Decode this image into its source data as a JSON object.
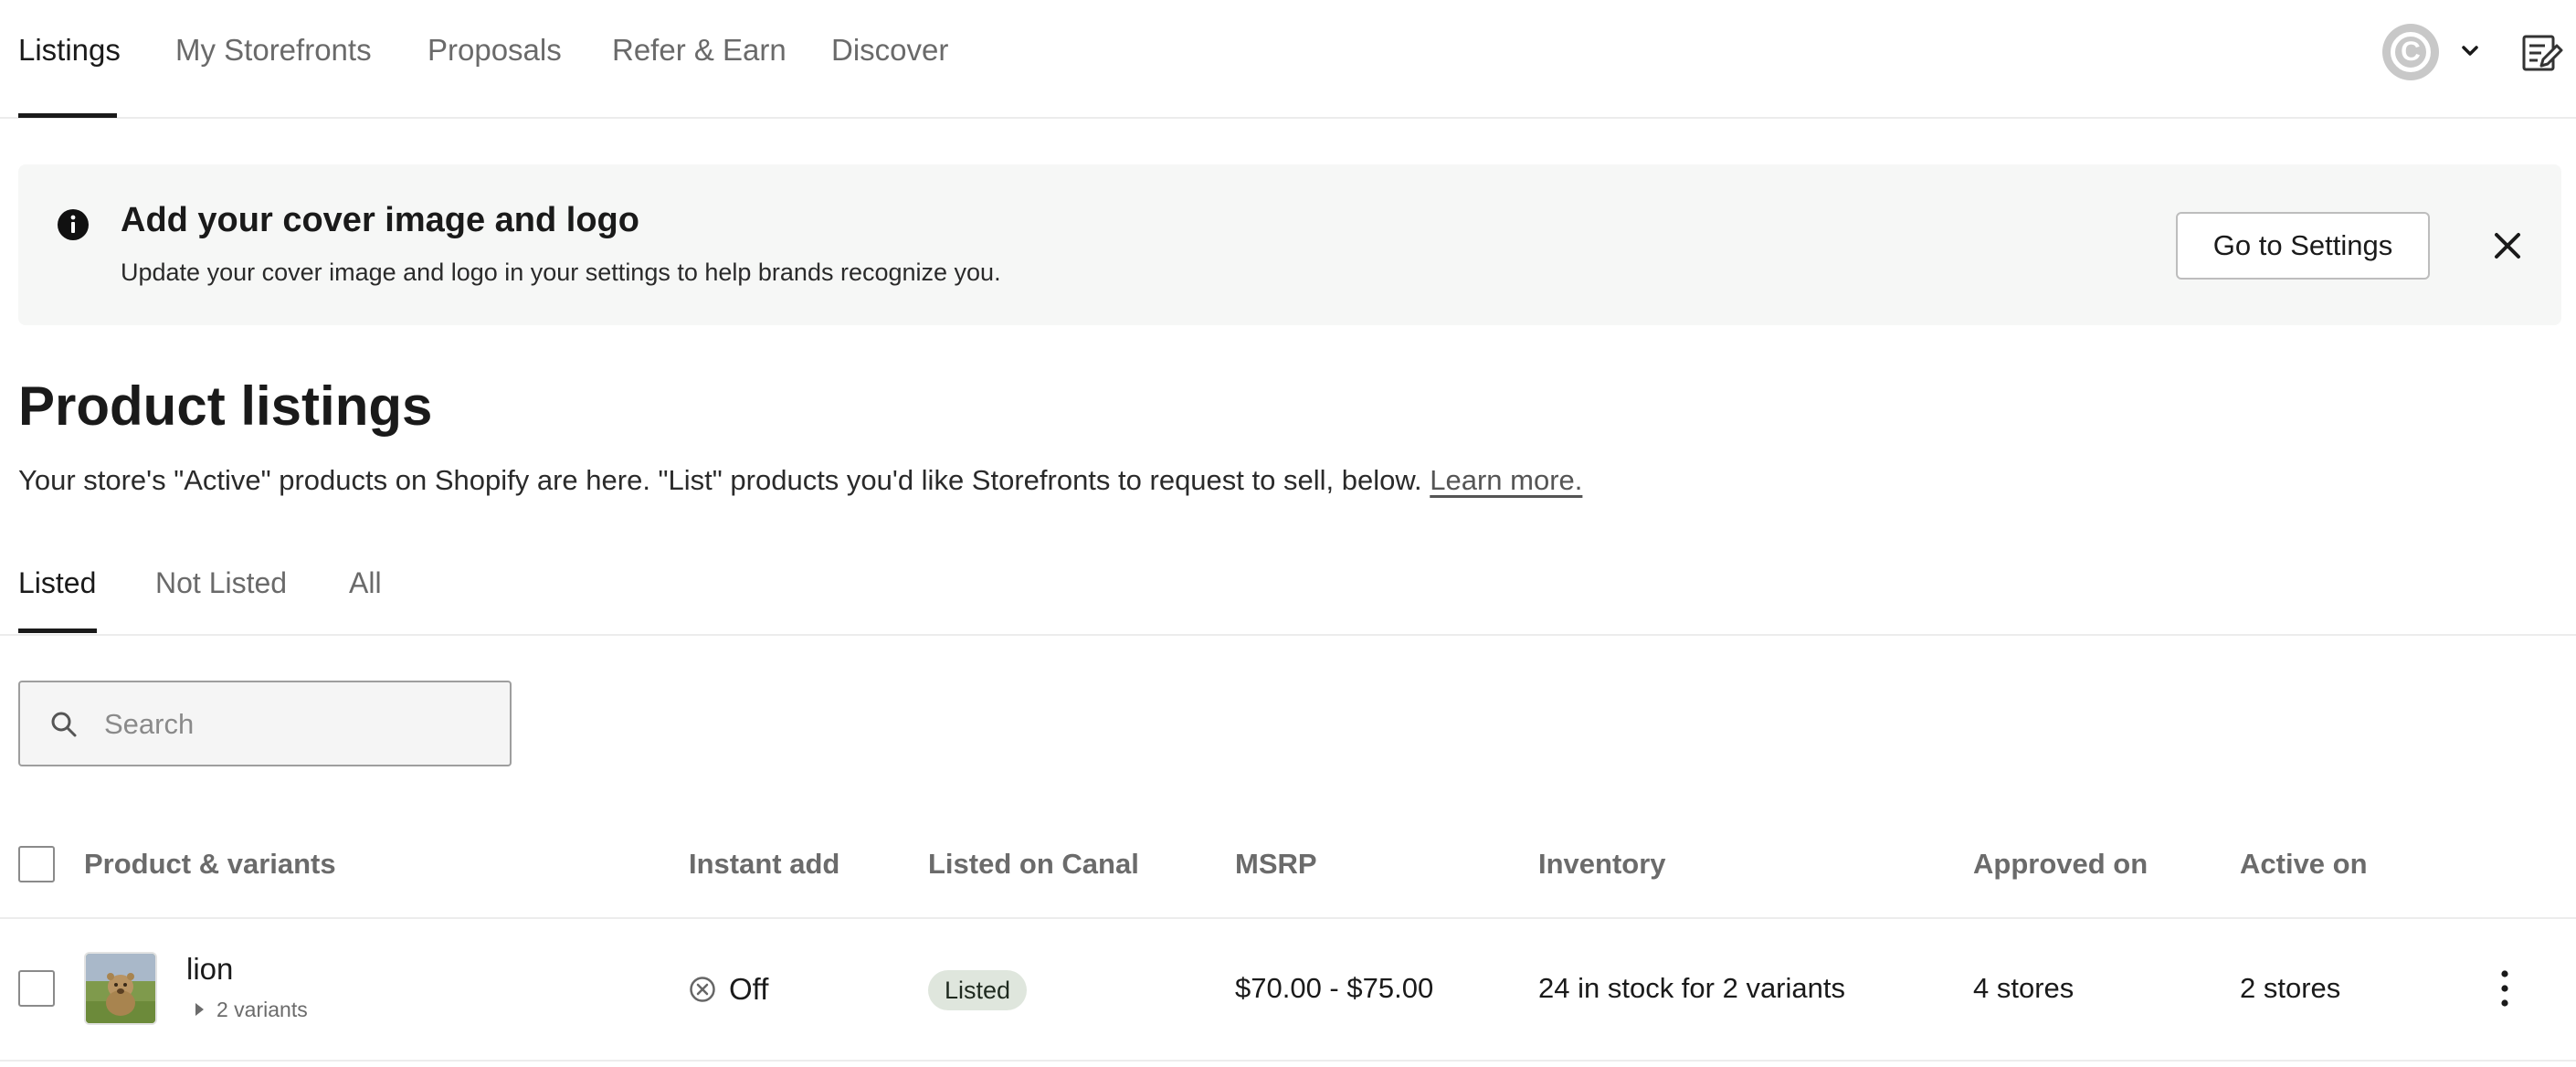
{
  "nav": {
    "tabs": [
      {
        "label": "Listings",
        "active": true
      },
      {
        "label": "My Storefronts",
        "active": false
      },
      {
        "label": "Proposals",
        "active": false
      },
      {
        "label": "Refer & Earn",
        "active": false
      },
      {
        "label": "Discover",
        "active": false
      }
    ],
    "avatar_initial": "C"
  },
  "banner": {
    "title": "Add your cover image and logo",
    "text": "Update your cover image and logo in your settings to help brands recognize you.",
    "button_label": "Go to Settings"
  },
  "page": {
    "title": "Product listings",
    "description": "Your store's \"Active\" products on Shopify are here. \"List\" products you'd like Storefronts to request to sell, below.",
    "learn_more": "Learn more."
  },
  "subtabs": [
    {
      "label": "Listed",
      "active": true
    },
    {
      "label": "Not Listed",
      "active": false
    },
    {
      "label": "All",
      "active": false
    }
  ],
  "search": {
    "placeholder": "Search",
    "value": ""
  },
  "table": {
    "columns": [
      "Product & variants",
      "Instant add",
      "Listed on Canal",
      "MSRP",
      "Inventory",
      "Approved on",
      "Active on"
    ],
    "rows": [
      {
        "name": "lion",
        "variants": "2 variants",
        "instant_add": "Off",
        "listed_status": "Listed",
        "msrp": "$70.00 - $75.00",
        "inventory": "24 in stock for 2 variants",
        "approved_on": "4 stores",
        "active_on": "2 stores"
      }
    ]
  },
  "colors": {
    "text": "#1a1a1a",
    "muted": "#6b6b6b",
    "banner_bg": "#f6f7f6",
    "badge_bg": "#dfe6dd",
    "avatar_bg": "#c8c8c8",
    "divider": "#ececec"
  },
  "icons": [
    "chevron-down-icon",
    "notes-icon",
    "info-icon",
    "close-icon",
    "search-icon",
    "off-circle-x-icon",
    "caret-right-icon",
    "kebab-menu-icon"
  ]
}
